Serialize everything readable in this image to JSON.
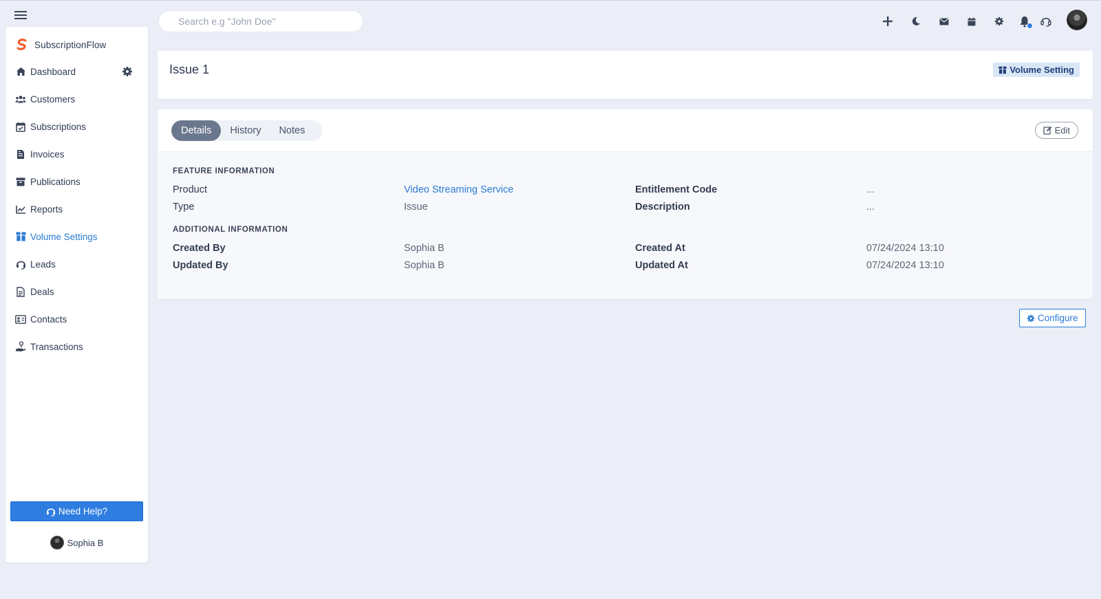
{
  "app": {
    "name": "SubscriptionFlow"
  },
  "search": {
    "placeholder": "Search e.g \"John Doe\""
  },
  "sidebar": {
    "items": [
      {
        "label": "Dashboard",
        "icon": "home-icon"
      },
      {
        "label": "Customers",
        "icon": "users-icon"
      },
      {
        "label": "Subscriptions",
        "icon": "calendar-check-icon"
      },
      {
        "label": "Invoices",
        "icon": "invoice-icon"
      },
      {
        "label": "Publications",
        "icon": "archive-icon"
      },
      {
        "label": "Reports",
        "icon": "chart-line-icon"
      },
      {
        "label": "Volume Settings",
        "icon": "box-icon",
        "active": true
      },
      {
        "label": "Leads",
        "icon": "headset-icon"
      },
      {
        "label": "Deals",
        "icon": "document-icon"
      },
      {
        "label": "Contacts",
        "icon": "contact-card-icon"
      },
      {
        "label": "Transactions",
        "icon": "hand-coins-icon"
      }
    ],
    "help_label": "Need Help?",
    "user_name": "Sophia B"
  },
  "page": {
    "title": "Issue 1",
    "volume_button": "Volume Setting"
  },
  "tabs": [
    {
      "label": "Details",
      "active": true
    },
    {
      "label": "History"
    },
    {
      "label": "Notes"
    }
  ],
  "edit_label": "Edit",
  "feature_info": {
    "heading": "FEATURE INFORMATION",
    "product_label": "Product",
    "product_value": "Video Streaming Service",
    "type_label": "Type",
    "type_value": "Issue",
    "entitlement_label": "Entitlement Code",
    "entitlement_value": "...",
    "description_label": "Description",
    "description_value": "..."
  },
  "additional_info": {
    "heading": "ADDITIONAL INFORMATION",
    "created_by_label": "Created By",
    "created_by_value": "Sophia B",
    "updated_by_label": "Updated By",
    "updated_by_value": "Sophia B",
    "created_at_label": "Created At",
    "created_at_value": "07/24/2024 13:10",
    "updated_at_label": "Updated At",
    "updated_at_value": "07/24/2024 13:10"
  },
  "configure_label": "Configure",
  "colors": {
    "accent": "#2f7de0",
    "link": "#2a7bd4",
    "brand_orange": "#f15a24",
    "background": "#ebeef6"
  }
}
